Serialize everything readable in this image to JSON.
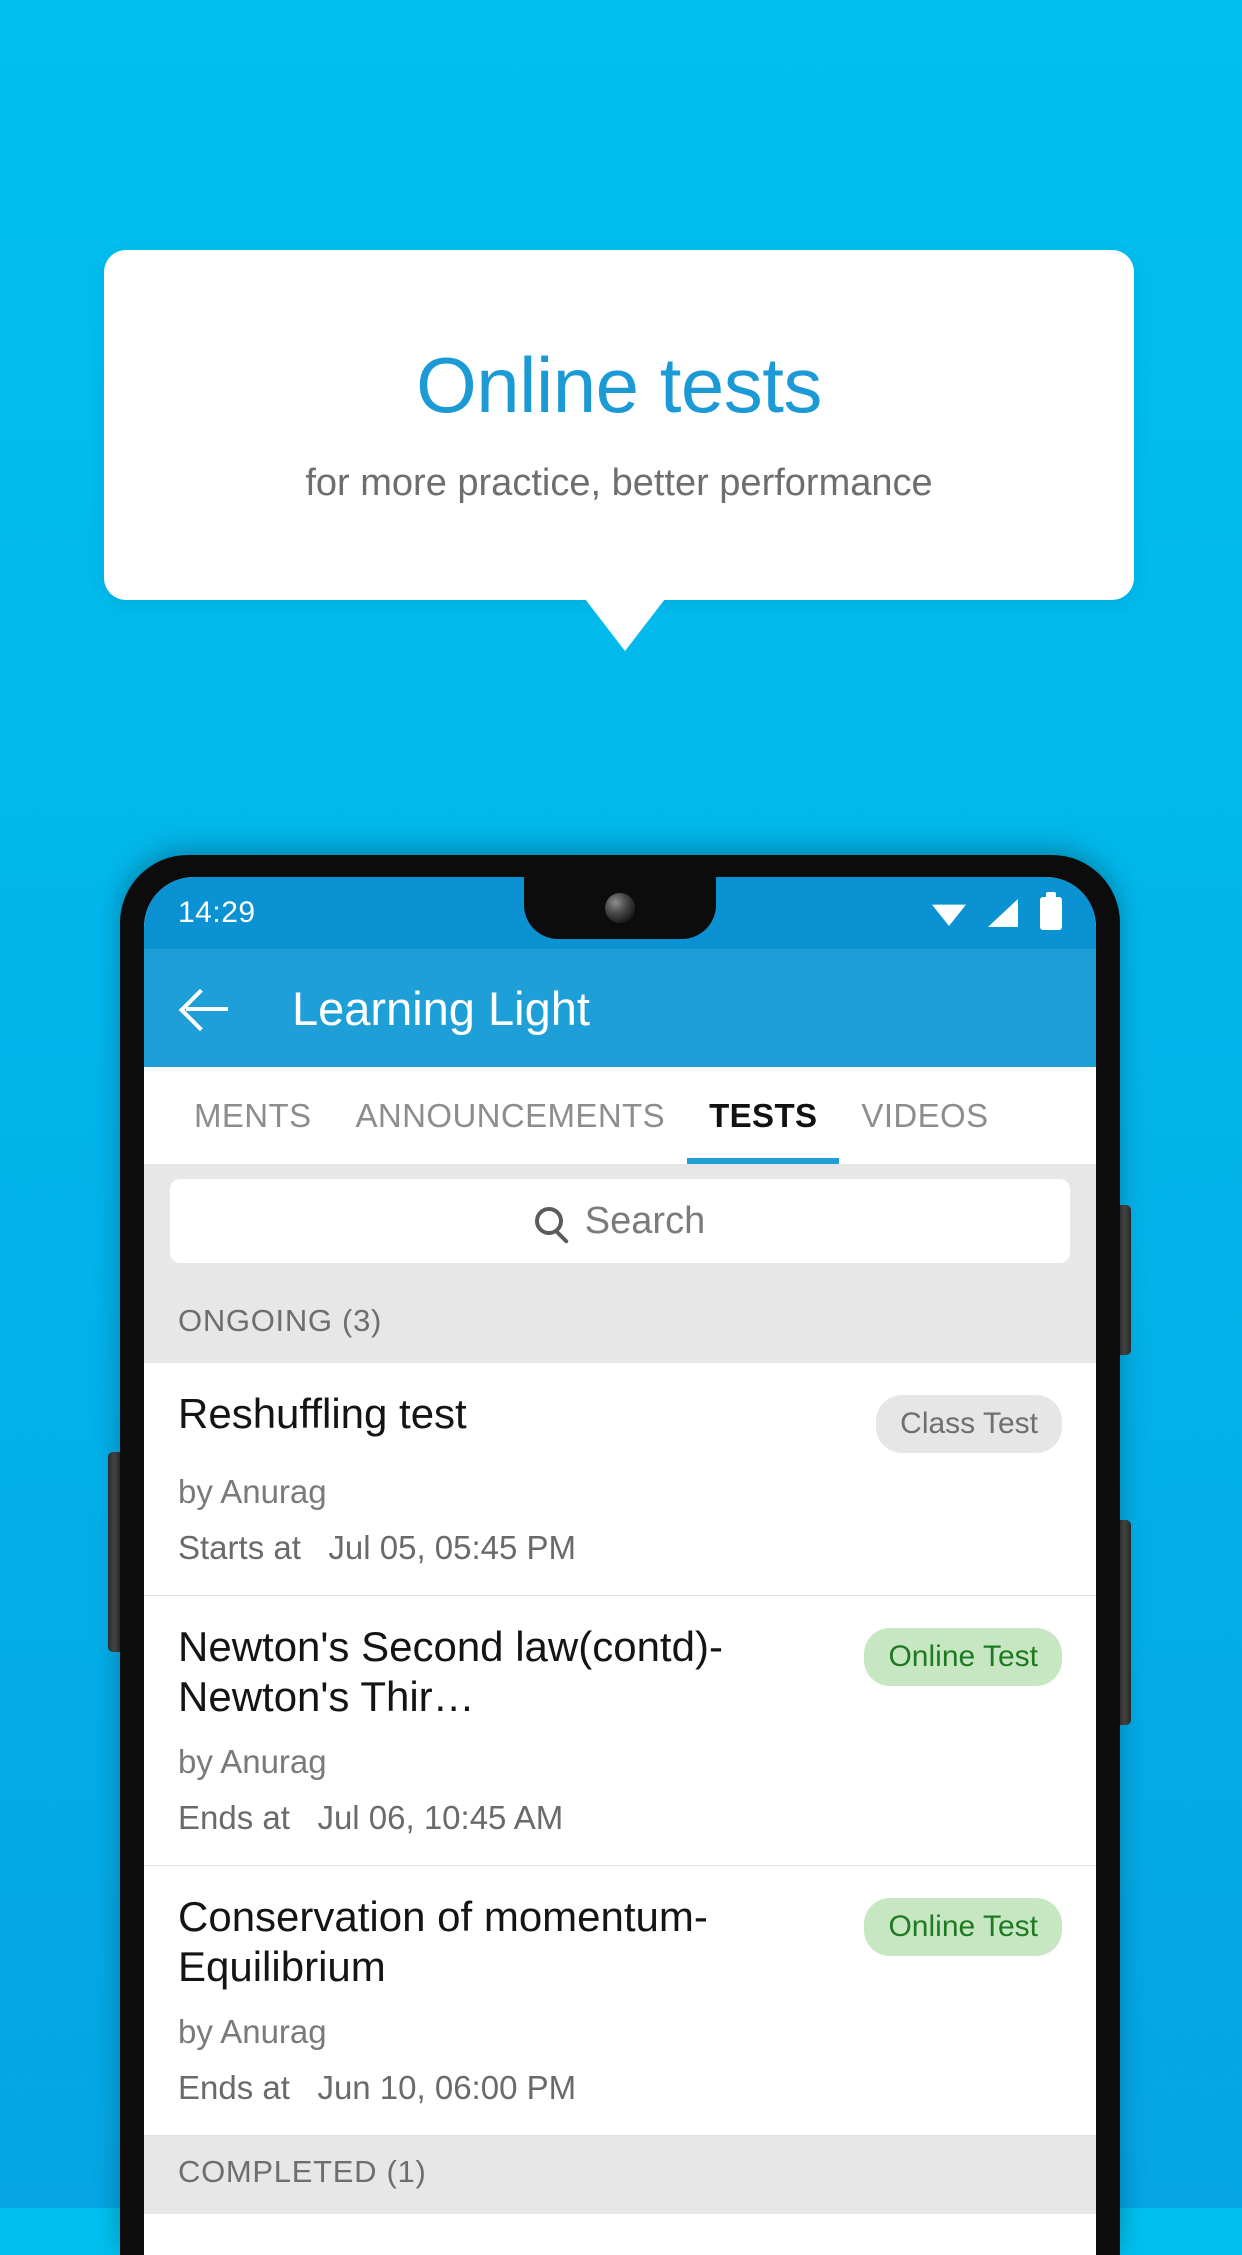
{
  "promo": {
    "title": "Online tests",
    "subtitle": "for more practice, better performance"
  },
  "phone": {
    "status_bar": {
      "clock": "14:29",
      "icons": [
        "wifi-icon",
        "signal-icon",
        "battery-icon"
      ]
    },
    "app_bar": {
      "back_icon": "arrow-left-icon",
      "title": "Learning Light"
    },
    "tabs": [
      {
        "label": "MENTS",
        "active": false
      },
      {
        "label": "ANNOUNCEMENTS",
        "active": false
      },
      {
        "label": "TESTS",
        "active": true
      },
      {
        "label": "VIDEOS",
        "active": false
      }
    ],
    "search": {
      "icon": "search-icon",
      "placeholder": "Search",
      "value": ""
    },
    "sections": [
      {
        "header": "ONGOING (3)"
      },
      {
        "header": "COMPLETED (1)"
      }
    ],
    "tests": [
      {
        "title": "Reshuffling test",
        "badge": "Class Test",
        "badge_style": "grey",
        "author": "by Anurag",
        "time_label": "Starts at",
        "time_value": "Jul 05, 05:45 PM"
      },
      {
        "title": "Newton's Second law(contd)-Newton's Thir…",
        "badge": "Online Test",
        "badge_style": "green",
        "author": "by Anurag",
        "time_label": "Ends at",
        "time_value": "Jul 06, 10:45 AM"
      },
      {
        "title": "Conservation of momentum-Equilibrium",
        "badge": "Online Test",
        "badge_style": "green",
        "author": "by Anurag",
        "time_label": "Ends at",
        "time_value": "Jun 10, 06:00 PM"
      }
    ]
  },
  "colors": {
    "background_top": "#00c0ef",
    "background_bottom": "#05a5e4",
    "app_bar": "#1e9fd8",
    "status_bar": "#0a92d2",
    "accent": "#1f9ed6",
    "badge_green_bg": "#c7e7c3",
    "badge_green_text": "#1f7a22",
    "badge_grey_bg": "#e6e6e6"
  }
}
